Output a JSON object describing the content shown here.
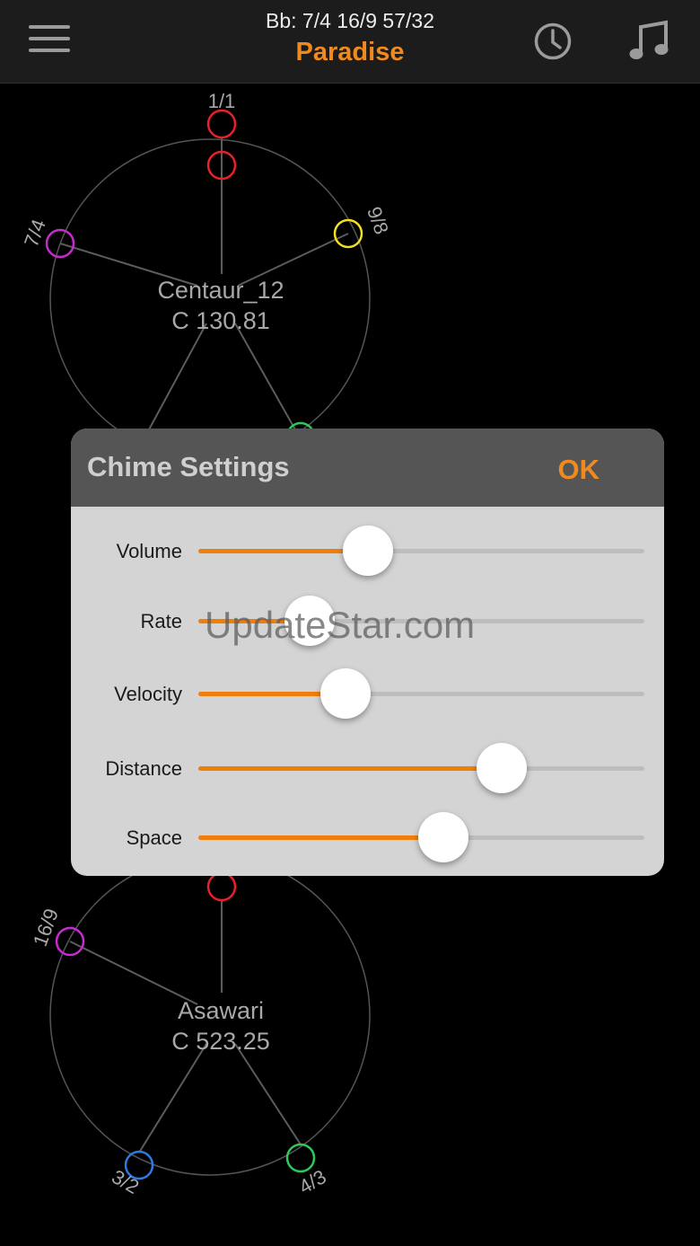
{
  "header": {
    "subtitle": "Bb: 7/4 16/9 57/32",
    "title": "Paradise",
    "accent_color": "#f08a1e",
    "icons": [
      "hamburger-menu-icon",
      "clock-icon",
      "music-note-icon"
    ]
  },
  "top_wheel": {
    "name": "Centaur_12",
    "pitch": "C 130.81",
    "nodes": [
      {
        "label": "1/1",
        "color": "#e8202a"
      },
      {
        "label": "",
        "color": "#e8202a"
      },
      {
        "label": "9/8",
        "color": "#f2e01e"
      },
      {
        "label": "7/4",
        "color": "#c92ad0"
      },
      {
        "label": "",
        "color": "#2ec95a"
      }
    ]
  },
  "bottom_wheel": {
    "name": "Asawari",
    "pitch": "C 523.25",
    "nodes": [
      {
        "label": "",
        "color": "#e8202a"
      },
      {
        "label": "16/9",
        "color": "#c92ad0"
      },
      {
        "label": "3/2",
        "color": "#2c7be0"
      },
      {
        "label": "4/3",
        "color": "#2ec95a"
      }
    ]
  },
  "chime_settings": {
    "title": "Chime Settings",
    "ok_label": "OK",
    "sliders": [
      {
        "label": "Volume",
        "value": 0.38
      },
      {
        "label": "Rate",
        "value": 0.25
      },
      {
        "label": "Velocity",
        "value": 0.33
      },
      {
        "label": "Distance",
        "value": 0.68
      },
      {
        "label": "Space",
        "value": 0.55
      }
    ],
    "fill_color": "#f07f0a"
  },
  "watermark": "UpdateStar.com"
}
